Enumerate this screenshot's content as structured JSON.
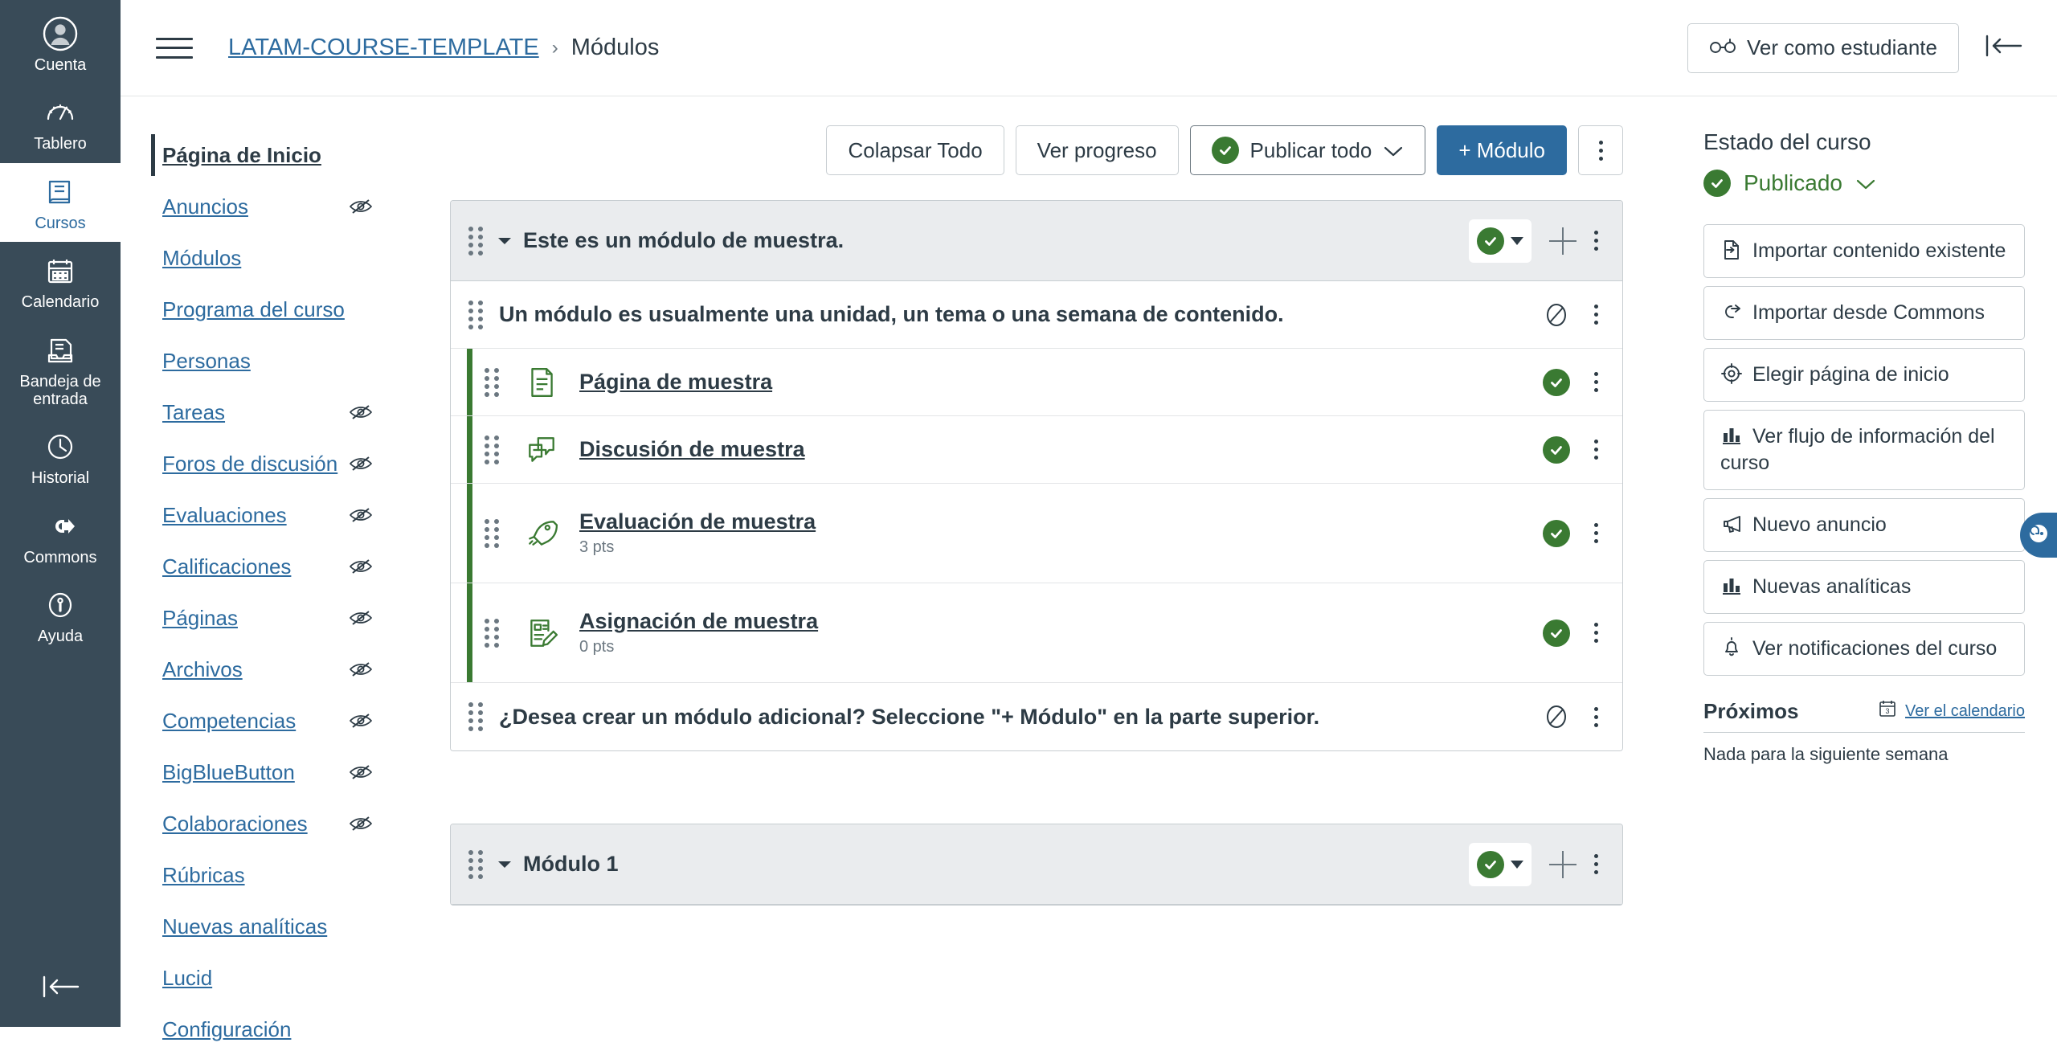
{
  "global_nav": {
    "items": [
      {
        "label": "Cuenta",
        "icon": "account-avatar-icon",
        "active": false
      },
      {
        "label": "Tablero",
        "icon": "dashboard-icon",
        "active": false
      },
      {
        "label": "Cursos",
        "icon": "courses-book-icon",
        "active": true
      },
      {
        "label": "Calendario",
        "icon": "calendar-icon",
        "active": false
      },
      {
        "label": "Bandeja de entrada",
        "icon": "inbox-icon",
        "active": false
      },
      {
        "label": "Historial",
        "icon": "clock-icon",
        "active": false
      },
      {
        "label": "Commons",
        "icon": "commons-arrow-icon",
        "active": false
      },
      {
        "label": "Ayuda",
        "icon": "help-info-icon",
        "active": false
      }
    ],
    "collapse_icon": "collapse-left-icon"
  },
  "header": {
    "menu_icon": "hamburger-menu-icon",
    "breadcrumb": {
      "course": "LATAM-COURSE-TEMPLATE",
      "separator": "›",
      "current": "Módulos"
    },
    "student_view_label": "Ver como estudiante",
    "student_view_icon": "eyeglasses-icon",
    "sidebar_collapse_icon": "collapse-right-icon"
  },
  "course_nav": {
    "items": [
      {
        "label": "Página de Inicio",
        "active": true,
        "hidden": false
      },
      {
        "label": "Anuncios",
        "active": false,
        "hidden": true
      },
      {
        "label": "Módulos",
        "active": false,
        "hidden": false
      },
      {
        "label": "Programa del curso",
        "active": false,
        "hidden": false
      },
      {
        "label": "Personas",
        "active": false,
        "hidden": false
      },
      {
        "label": "Tareas",
        "active": false,
        "hidden": true
      },
      {
        "label": "Foros de discusión",
        "active": false,
        "hidden": true
      },
      {
        "label": "Evaluaciones",
        "active": false,
        "hidden": true
      },
      {
        "label": "Calificaciones",
        "active": false,
        "hidden": true
      },
      {
        "label": "Páginas",
        "active": false,
        "hidden": true
      },
      {
        "label": "Archivos",
        "active": false,
        "hidden": true
      },
      {
        "label": "Competencias",
        "active": false,
        "hidden": true
      },
      {
        "label": "BigBlueButton",
        "active": false,
        "hidden": true
      },
      {
        "label": "Colaboraciones",
        "active": false,
        "hidden": true
      },
      {
        "label": "Rúbricas",
        "active": false,
        "hidden": false
      },
      {
        "label": "Nuevas analíticas",
        "active": false,
        "hidden": false
      },
      {
        "label": "Lucid",
        "active": false,
        "hidden": false
      },
      {
        "label": "Configuración",
        "active": false,
        "hidden": false
      }
    ],
    "hidden_icon": "eye-off-icon"
  },
  "toolbar": {
    "collapse_all_label": "Colapsar Todo",
    "view_progress_label": "Ver progreso",
    "publish_all_label": "Publicar todo",
    "publish_all_icon": "published-check-icon",
    "add_module_label": "+ Módulo",
    "more_icon": "kebab-menu-icon"
  },
  "modules": [
    {
      "title": "Este es un módulo de muestra.",
      "published": true,
      "drag_icon": "drag-handle-icon",
      "collapse_icon": "caret-down-icon",
      "publish_icon": "published-check-icon",
      "add_icon": "plus-icon",
      "more_icon": "kebab-menu-icon",
      "rows": [
        {
          "kind": "text",
          "text": "Un módulo es usualmente una unidad, un tema o una semana de contenido.",
          "status_icon": "unpublished-circle-slash-icon",
          "more_icon": "kebab-menu-icon"
        },
        {
          "kind": "item",
          "title": "Página de muestra",
          "subtitle": "",
          "type_icon": "page-document-icon",
          "status_icon": "published-check-icon",
          "more_icon": "kebab-menu-icon"
        },
        {
          "kind": "item",
          "title": "Discusión de muestra",
          "subtitle": "",
          "type_icon": "discussion-bubbles-icon",
          "status_icon": "published-check-icon",
          "more_icon": "kebab-menu-icon"
        },
        {
          "kind": "item",
          "title": "Evaluación de muestra",
          "subtitle": "3 pts",
          "type_icon": "quiz-rocket-icon",
          "status_icon": "published-check-icon",
          "more_icon": "kebab-menu-icon"
        },
        {
          "kind": "item",
          "title": "Asignación de muestra",
          "subtitle": "0 pts",
          "type_icon": "assignment-pencil-icon",
          "status_icon": "published-check-icon",
          "more_icon": "kebab-menu-icon"
        },
        {
          "kind": "text",
          "text": "¿Desea crear un módulo adicional? Seleccione \"+ Módulo\" en la parte superior.",
          "status_icon": "unpublished-circle-slash-icon",
          "more_icon": "kebab-menu-icon"
        }
      ]
    },
    {
      "title": "Módulo 1",
      "published": true,
      "drag_icon": "drag-handle-icon",
      "collapse_icon": "caret-down-icon",
      "publish_icon": "published-check-icon",
      "add_icon": "plus-icon",
      "more_icon": "kebab-menu-icon",
      "rows": []
    }
  ],
  "right_sidebar": {
    "status_title": "Estado del curso",
    "status_value": "Publicado",
    "status_icon": "published-check-icon",
    "status_caret_icon": "chevron-down-icon",
    "buttons": [
      {
        "label": "Importar contenido existente",
        "icon": "import-content-icon"
      },
      {
        "label": "Importar desde Commons",
        "icon": "commons-arrow-icon"
      },
      {
        "label": "Elegir página de inicio",
        "icon": "target-home-icon"
      },
      {
        "label": "Ver flujo de información del curso",
        "icon": "bar-chart-icon"
      },
      {
        "label": "Nuevo anuncio",
        "icon": "megaphone-icon"
      },
      {
        "label": "Nuevas analíticas",
        "icon": "bar-chart-icon"
      },
      {
        "label": "Ver notificaciones del curso",
        "icon": "bell-icon"
      }
    ],
    "upcoming_title": "Próximos",
    "view_calendar_label": "Ver el calendario",
    "view_calendar_icon": "calendar-small-icon",
    "upcoming_empty": "Nada para la siguiente semana"
  },
  "help_tab": {
    "icon": "help-chat-icon"
  },
  "colors": {
    "nav_bg": "#394B58",
    "link_blue": "#2D6B9F",
    "primary_blue": "#2D6B9F",
    "published_green": "#3A7A32",
    "text": "#2D3B45",
    "module_header_bg": "#EAECEE",
    "border": "#C7CDD1"
  }
}
